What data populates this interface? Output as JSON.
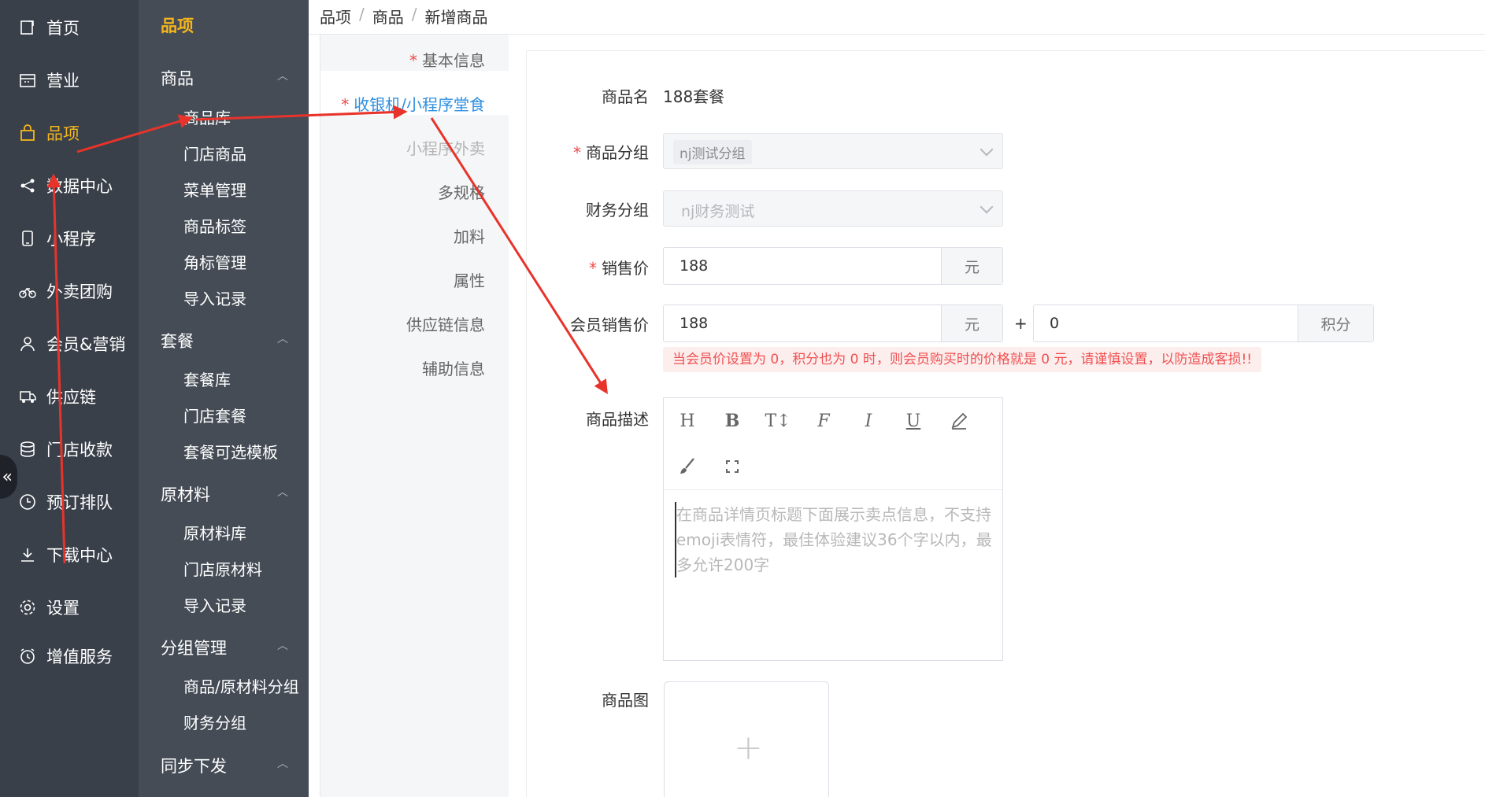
{
  "nav": {
    "items": [
      {
        "label": "首页",
        "icon": "home-icon"
      },
      {
        "label": "营业",
        "icon": "calendar-icon"
      },
      {
        "label": "品项",
        "icon": "shopping-bag-icon",
        "active": true
      },
      {
        "label": "数据中心",
        "icon": "share-icon"
      },
      {
        "label": "小程序",
        "icon": "mobile-icon"
      },
      {
        "label": "外卖团购",
        "icon": "bicycle-icon"
      },
      {
        "label": "会员&营销",
        "icon": "user-icon"
      },
      {
        "label": "供应链",
        "icon": "truck-icon"
      },
      {
        "label": "门店收款",
        "icon": "database-icon"
      },
      {
        "label": "预订排队",
        "icon": "clock-icon"
      },
      {
        "label": "下载中心",
        "icon": "download-icon"
      },
      {
        "label": "设置",
        "icon": "gear-icon"
      },
      {
        "label": "增值服务",
        "icon": "alarm-icon"
      }
    ],
    "collapse_glyph": "«"
  },
  "subnav": {
    "title": "品项",
    "sections": [
      {
        "label": "商品",
        "items": [
          "商品库",
          "门店商品",
          "菜单管理",
          "商品标签",
          "角标管理",
          "导入记录"
        ]
      },
      {
        "label": "套餐",
        "items": [
          "套餐库",
          "门店套餐",
          "套餐可选模板"
        ]
      },
      {
        "label": "原材料",
        "items": [
          "原材料库",
          "门店原材料",
          "导入记录"
        ]
      },
      {
        "label": "分组管理",
        "items": [
          "商品/原材料分组",
          "财务分组"
        ]
      },
      {
        "label": "同步下发",
        "items": []
      }
    ]
  },
  "breadcrumb": [
    "品项",
    "商品",
    "新增商品"
  ],
  "breadcrumb_sep": "/",
  "steps": [
    {
      "label": "基本信息",
      "required": true
    },
    {
      "label": "收银机/小程序堂食",
      "required": true,
      "active": true
    },
    {
      "label": "小程序外卖",
      "disabled": true
    },
    {
      "label": "多规格"
    },
    {
      "label": "加料"
    },
    {
      "label": "属性"
    },
    {
      "label": "供应链信息"
    },
    {
      "label": "辅助信息"
    }
  ],
  "form": {
    "name_label": "商品名",
    "name_value": "188套餐",
    "group_label": "商品分组",
    "group_value": "nj测试分组",
    "finance_label": "财务分组",
    "finance_placeholder": "nj财务测试",
    "price_label": "销售价",
    "price_value": "188",
    "price_unit": "元",
    "member_label": "会员销售价",
    "member_price_value": "188",
    "member_price_unit": "元",
    "plus": "+",
    "points_value": "0",
    "points_unit": "积分",
    "warning": "当会员价设置为 0，积分也为 0 时，则会员购买时的价格就是 0 元，请谨慎设置，以防造成客损!!",
    "desc_label": "商品描述",
    "desc_placeholder": "在商品详情页标题下面展示卖点信息，不支持emoji表情符，最佳体验建议36个字以内，最多允许200字",
    "image_label": "商品图",
    "upload_plus": "+",
    "required_mark": "*"
  },
  "editor_tools": [
    "H",
    "B",
    "T↕",
    "F",
    "I",
    "U",
    "pen",
    "brush",
    "fullscreen"
  ],
  "colors": {
    "nav_bg": "#3a404a",
    "subnav_bg": "#454c56",
    "accent": "#f4b61c",
    "active_step": "#2f8fe0",
    "annotation": "#e8332a"
  }
}
